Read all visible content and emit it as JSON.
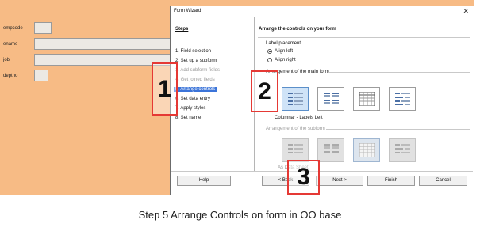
{
  "form": {
    "fields": [
      {
        "label": "empcode"
      },
      {
        "label": "ename"
      },
      {
        "label": "job"
      },
      {
        "label": "deptno"
      }
    ]
  },
  "dialog": {
    "title": "Form Wizard",
    "close_glyph": "✕",
    "steps_header": "Steps",
    "steps": [
      {
        "label": "1. Field selection",
        "state": "normal"
      },
      {
        "label": "2. Set up a subform",
        "state": "normal"
      },
      {
        "label": "3. Add subform fields",
        "state": "disabled"
      },
      {
        "label": "4. Get joined fields",
        "state": "disabled"
      },
      {
        "label": "5. Arrange controls",
        "state": "selected"
      },
      {
        "label": "6. Set data entry",
        "state": "normal"
      },
      {
        "label": "7. Apply styles",
        "state": "normal"
      },
      {
        "label": "8. Set name",
        "state": "normal"
      }
    ],
    "content_header": "Arrange the controls on your form",
    "label_placement": {
      "title": "Label placement",
      "options": [
        "Align left",
        "Align right"
      ],
      "selected": "Align left"
    },
    "main_form": {
      "title": "Arrangement of the main form",
      "selected_layout": "Columnar - Labels Left"
    },
    "subform": {
      "title": "Arrangement of the subform",
      "selected_layout": "As Data Sheet"
    },
    "buttons": {
      "help": "Help",
      "back": "< Back",
      "next": "Next >",
      "finish": "Finish",
      "cancel": "Cancel"
    }
  },
  "annotations": {
    "one": "1",
    "two": "2",
    "three": "3",
    "color": "#e53935"
  },
  "caption": "Step 5 Arrange Controls on form in OO base"
}
